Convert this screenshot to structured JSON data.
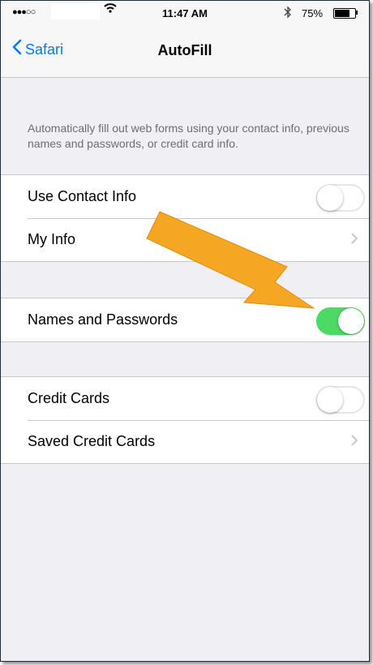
{
  "status_bar": {
    "signal": "●●●○○",
    "time": "11:47 AM",
    "battery": "75%",
    "battery_level": 0.75
  },
  "nav": {
    "back_label": "Safari",
    "title": "AutoFill"
  },
  "description": "Automatically fill out web forms using your contact info, previous names and passwords, or credit card info.",
  "groups": [
    {
      "rows": [
        {
          "label": "Use Contact Info",
          "type": "toggle",
          "on": false
        },
        {
          "label": "My Info",
          "type": "disclosure"
        }
      ]
    },
    {
      "rows": [
        {
          "label": "Names and Passwords",
          "type": "toggle",
          "on": true
        }
      ]
    },
    {
      "rows": [
        {
          "label": "Credit Cards",
          "type": "toggle",
          "on": false
        },
        {
          "label": "Saved Credit Cards",
          "type": "disclosure"
        }
      ]
    }
  ],
  "colors": {
    "accent": "#007aff",
    "toggle_on": "#4cd964",
    "annotation_arrow": "#f5a623"
  },
  "icons": {
    "back": "chevron-left-icon",
    "disclosure": "chevron-right-icon",
    "wifi": "wifi-icon",
    "bluetooth": "bluetooth-icon",
    "battery": "battery-icon"
  }
}
